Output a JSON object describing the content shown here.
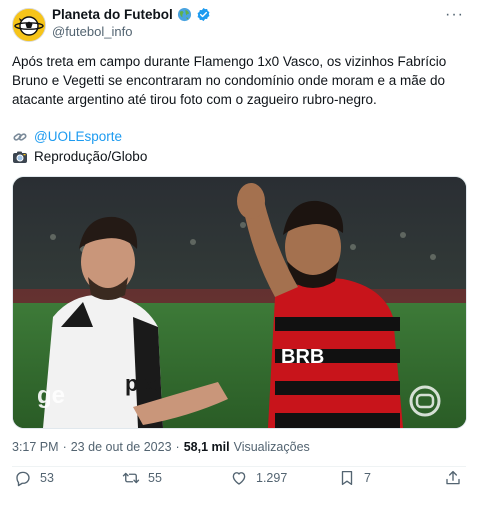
{
  "author": {
    "display_name": "Planeta do Futebol",
    "handle": "@futebol_info",
    "badges": [
      "globe-emoji-icon",
      "verified-badge-icon"
    ]
  },
  "more_menu_label": "···",
  "tweet": {
    "text": "Após treta em campo durante Flamengo 1x0 Vasco, os vizinhos Fabrício Bruno e Vegetti se encontraram no condomínio onde moram e a mãe do atacante argentino até tirou foto com o zagueiro rubro-negro.",
    "credit_icon_1": "link-emoji-icon",
    "credit_handle": "@UOLEsporte",
    "credit_icon_2": "camera-emoji-icon",
    "credit_source": "Reprodução/Globo"
  },
  "media": {
    "watermark_left": "ge",
    "jersey_text_left": "pix",
    "jersey_text_right": "BRB",
    "accent_red": "#d0121b",
    "accent_pitch": "#2f6a2c"
  },
  "meta": {
    "time": "3:17 PM",
    "sep1": "·",
    "date": "23 de out de 2023",
    "sep2": "·",
    "views_count": "58,1 mil",
    "views_label": "Visualizações"
  },
  "actions": {
    "replies": "53",
    "retweets": "55",
    "likes": "1.297",
    "bookmarks": "7"
  }
}
